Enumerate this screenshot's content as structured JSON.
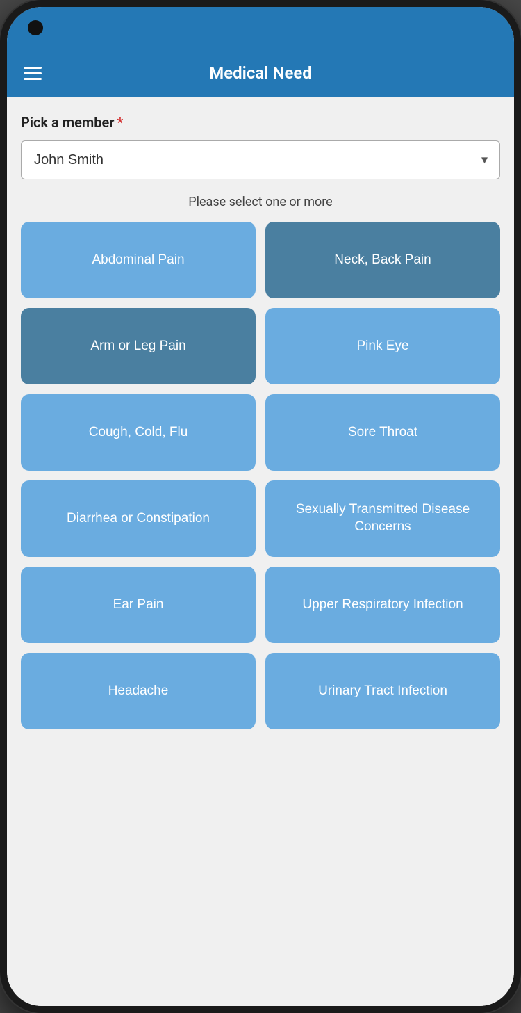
{
  "phone": {
    "header": {
      "title": "Medical Need",
      "menu_icon": "hamburger-icon"
    },
    "form": {
      "pick_member_label": "Pick a member",
      "required": true,
      "select": {
        "value": "John Smith",
        "options": [
          "John Smith"
        ]
      },
      "instruction": "Please select one or more",
      "conditions": [
        {
          "id": "abdominal-pain",
          "label": "Abdominal Pain",
          "variant": "light",
          "selected": false
        },
        {
          "id": "neck-back-pain",
          "label": "Neck, Back Pain",
          "variant": "dark",
          "selected": false
        },
        {
          "id": "arm-leg-pain",
          "label": "Arm or Leg Pain",
          "variant": "dark",
          "selected": true
        },
        {
          "id": "pink-eye",
          "label": "Pink Eye",
          "variant": "light",
          "selected": false
        },
        {
          "id": "cough-cold-flu",
          "label": "Cough, Cold, Flu",
          "variant": "light",
          "selected": false
        },
        {
          "id": "sore-throat",
          "label": "Sore Throat",
          "variant": "light",
          "selected": false
        },
        {
          "id": "diarrhea-constipation",
          "label": "Diarrhea or Constipation",
          "variant": "light",
          "selected": false
        },
        {
          "id": "std-concerns",
          "label": "Sexually Transmitted Disease Concerns",
          "variant": "light",
          "selected": false
        },
        {
          "id": "ear-pain",
          "label": "Ear Pain",
          "variant": "light",
          "selected": false
        },
        {
          "id": "upper-respiratory",
          "label": "Upper Respiratory Infection",
          "variant": "light",
          "selected": false
        },
        {
          "id": "headache",
          "label": "Headache",
          "variant": "light",
          "selected": false
        },
        {
          "id": "urinary-tract",
          "label": "Urinary Tract Infection",
          "variant": "light",
          "selected": false
        }
      ]
    }
  }
}
